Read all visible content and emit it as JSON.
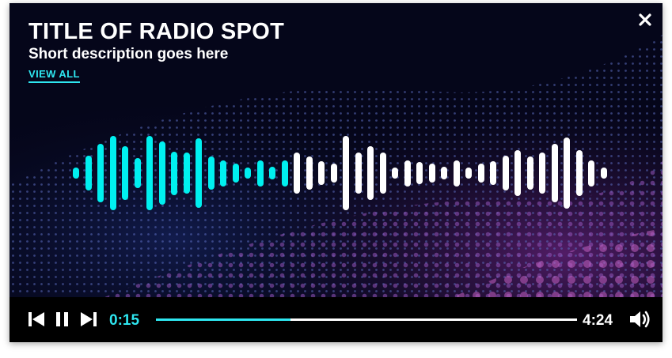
{
  "spot": {
    "title": "TITLE OF RADIO SPOT",
    "description": "Short description goes here",
    "view_all_label": "VIEW ALL"
  },
  "player": {
    "current_time": "0:15",
    "total_time": "4:24",
    "progress_fraction": 0.32,
    "accent_color": "#2ee6f0"
  },
  "waveform": {
    "played_color": "#00f0f0",
    "unplayed_color": "#ffffff",
    "played_count": 18,
    "levels": [
      0.12,
      0.4,
      0.68,
      0.85,
      0.62,
      0.35,
      0.85,
      0.72,
      0.5,
      0.48,
      0.8,
      0.38,
      0.3,
      0.22,
      0.12,
      0.3,
      0.14,
      0.3,
      0.48,
      0.38,
      0.28,
      0.22,
      0.85,
      0.48,
      0.62,
      0.48,
      0.12,
      0.3,
      0.25,
      0.22,
      0.14,
      0.3,
      0.12,
      0.22,
      0.28,
      0.4,
      0.52,
      0.38,
      0.48,
      0.68,
      0.82,
      0.52,
      0.3,
      0.12
    ]
  },
  "icons": {
    "close": "close-icon",
    "previous": "skip-previous-icon",
    "pause": "pause-icon",
    "next": "skip-next-icon",
    "volume": "volume-icon"
  }
}
